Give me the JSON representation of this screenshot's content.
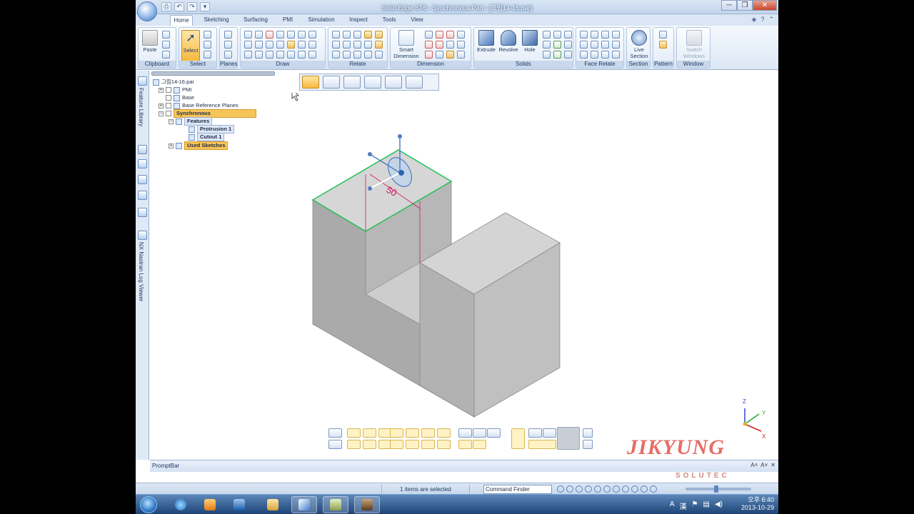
{
  "window": {
    "title": "Solid Edge ST6 - Synchronous Part - [그림14-16.par]",
    "controls": [
      "─",
      "❐",
      "✕"
    ]
  },
  "qat": [
    "⎙",
    "↶",
    "↷",
    "▾"
  ],
  "tabs": [
    "Home",
    "Sketching",
    "Surfacing",
    "PMI",
    "Simulation",
    "Inspect",
    "Tools",
    "View"
  ],
  "ribbon": {
    "clipboard": {
      "paste": "Paste",
      "label": "Clipboard"
    },
    "select": {
      "select": "Select",
      "label": "Select"
    },
    "planes": {
      "label": "Planes"
    },
    "draw": {
      "label": "Draw"
    },
    "relate": {
      "label": "Relate"
    },
    "dimension": {
      "smart_dimension": "Smart Dimension",
      "label": "Dimension"
    },
    "solids": {
      "extrude": "Extrude",
      "revolve": "Revolve",
      "hole": "Hole",
      "label": "Solids"
    },
    "face_relate": {
      "label": "Face Relate"
    },
    "section": {
      "live_section": "Live Section",
      "label": "Section"
    },
    "pattern": {
      "label": "Pattern"
    },
    "window": {
      "switch_windows": "Switch Windows",
      "label": "Window"
    }
  },
  "side_panels": {
    "feature_library": "Feature Library",
    "nastran": "NX Nastran Log Viewer"
  },
  "tree": {
    "root": "그림14-16.par",
    "pmi": "PMI",
    "base": "Base",
    "base_ref": "Base Reference Planes",
    "synchronous": "Synchronous",
    "features": "Features",
    "protrusion": "Protrusion 1",
    "cutout": "Cutout 1",
    "used_sketches": "Used Sketches"
  },
  "model": {
    "dimension_value": "50",
    "colors": {
      "top": "#d6d6d6",
      "left": "#a9a9a9",
      "right": "#c4c4c4",
      "edge_highlight": "#22c055",
      "dimension": "#d0185f"
    }
  },
  "triad": {
    "x": "X",
    "y": "Y",
    "z": "Z"
  },
  "promptbar": {
    "title": "PromptBar",
    "controls": [
      "A˄",
      "A˅",
      "✕"
    ]
  },
  "status": {
    "message": "1 items are selected",
    "command_finder": "Command Finder"
  },
  "watermark": {
    "name": "JIKYUNG",
    "sub": "SOLUTEC"
  },
  "taskbar": {
    "time": "오후 6:40",
    "date": "2013-10-29",
    "tray_icons": [
      "A",
      "漢",
      "⚑",
      "▤",
      "◀)"
    ]
  }
}
